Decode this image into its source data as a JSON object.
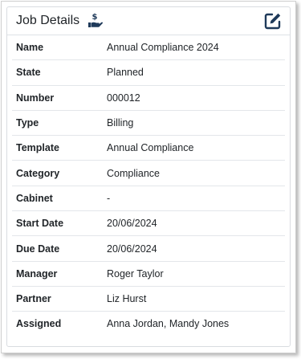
{
  "card": {
    "title": "Job Details",
    "title_icon": "hand-holding-dollar-icon",
    "edit_icon": "edit-icon"
  },
  "fields": [
    {
      "label": "Name",
      "value": "Annual Compliance 2024"
    },
    {
      "label": "State",
      "value": "Planned"
    },
    {
      "label": "Number",
      "value": "000012"
    },
    {
      "label": "Type",
      "value": "Billing"
    },
    {
      "label": "Template",
      "value": "Annual Compliance"
    },
    {
      "label": "Category",
      "value": "Compliance"
    },
    {
      "label": "Cabinet",
      "value": "-"
    },
    {
      "label": "Start Date",
      "value": "20/06/2024"
    },
    {
      "label": "Due Date",
      "value": "20/06/2024"
    },
    {
      "label": "Manager",
      "value": "Roger Taylor"
    },
    {
      "label": "Partner",
      "value": "Liz Hurst"
    },
    {
      "label": "Assigned",
      "value": "Anna Jordan, Mandy Jones"
    }
  ],
  "colors": {
    "text": "#212529",
    "icon": "#1f3a5a",
    "border": "#dee2e6"
  }
}
